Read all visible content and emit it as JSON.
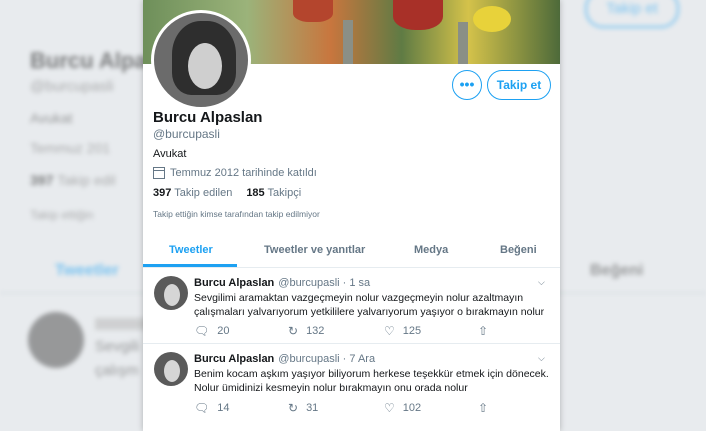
{
  "background": {
    "name": "Burcu Alpaslan",
    "handle": "@burcupasli",
    "bio": "Avukat",
    "joined": "Temmuz 201",
    "following": "397",
    "following_label": "Takip edil",
    "notice": "Takip ettiğin",
    "tab": "Tweetler",
    "tab2": "Beğeni",
    "follow_label": "Takip et",
    "tweet_text_a": "Sevgili",
    "tweet_text_b": "çalışm"
  },
  "profile": {
    "name": "Burcu Alpaslan",
    "handle": "@burcupasli",
    "bio": "Avukat",
    "joined": "Temmuz 2012 tarihinde katıldı",
    "following_count": "397",
    "following_label": "Takip edilen",
    "followers_count": "185",
    "followers_label": "Takipçi",
    "notice": "Takip ettiğin kimse tarafından takip edilmiyor",
    "more_label": "•••",
    "follow_label": "Takip et"
  },
  "tabs": [
    {
      "label": "Tweetler"
    },
    {
      "label": "Tweetler ve yanıtlar"
    },
    {
      "label": "Medya"
    },
    {
      "label": "Beğeni"
    }
  ],
  "tweets": [
    {
      "name": "Burcu Alpaslan",
      "handle": "@burcupasli",
      "time": "· 1 sa",
      "text": "Sevgilimi aramaktan vazgeçmeyin nolur vazgeçmeyin nolur azaltmayın çalışmaları yalvarıyorum yetkililere yalvarıyorum yaşıyor o bırakmayın nolur",
      "replies": "20",
      "retweets": "132",
      "likes": "125"
    },
    {
      "name": "Burcu Alpaslan",
      "handle": "@burcupasli",
      "time": "· 7 Ara",
      "text": "Benim kocam aşkım yaşıyor biliyorum herkese teşekkür etmek için dönecek. Nolur ümidinizi kesmeyin nolur bırakmayın onu orada nolur",
      "replies": "14",
      "retweets": "31",
      "likes": "102"
    }
  ],
  "icons": {
    "reply": "reply-icon",
    "retweet": "retweet-icon",
    "like": "heart-icon",
    "share": "share-icon",
    "calendar": "calendar-icon",
    "chevron": "chevron-down-icon"
  },
  "colors": {
    "accent": "#1da1f2",
    "text": "#14171a",
    "muted": "#657786"
  }
}
